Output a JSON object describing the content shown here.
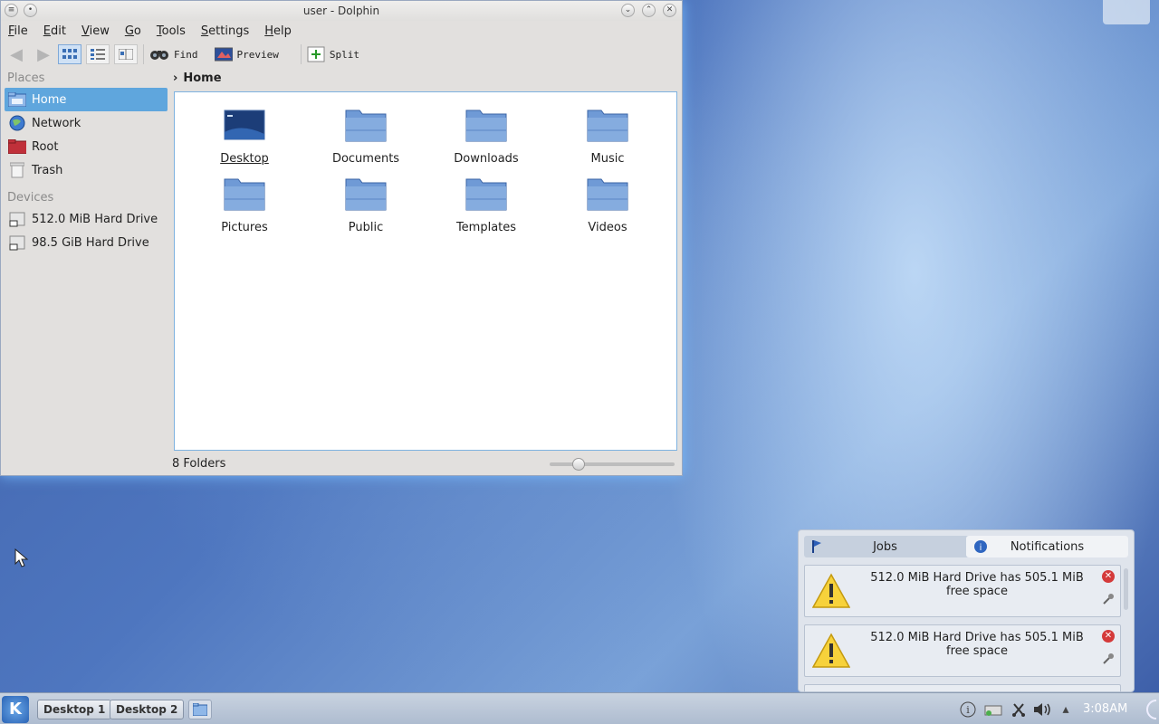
{
  "window": {
    "title": "user - Dolphin",
    "menu": [
      {
        "key": "F",
        "rest": "ile"
      },
      {
        "key": "E",
        "rest": "dit"
      },
      {
        "key": "V",
        "rest": "iew"
      },
      {
        "key": "G",
        "rest": "o"
      },
      {
        "key": "T",
        "rest": "ools"
      },
      {
        "key": "S",
        "rest": "ettings"
      },
      {
        "key": "H",
        "rest": "elp"
      }
    ],
    "toolbar": {
      "find_label": "Find",
      "preview_label": "Preview",
      "split_label": "Split"
    }
  },
  "places": {
    "places_heading": "Places",
    "items": [
      "Home",
      "Network",
      "Root",
      "Trash"
    ],
    "devices_heading": "Devices",
    "devices": [
      "512.0 MiB Hard Drive",
      "98.5 GiB Hard Drive"
    ]
  },
  "breadcrumb": {
    "current": "Home"
  },
  "files": [
    "Desktop",
    "Documents",
    "Downloads",
    "Music",
    "Pictures",
    "Public",
    "Templates",
    "Videos"
  ],
  "status": {
    "text": "8 Folders",
    "zoom_fraction": 0.2
  },
  "notifications": {
    "tab_jobs": "Jobs",
    "tab_notifications": "Notifications",
    "items": [
      "512.0 MiB Hard Drive has 505.1 MiB free space",
      "512.0 MiB Hard Drive has 505.1 MiB free space"
    ]
  },
  "taskbar": {
    "desktop1": "Desktop 1",
    "desktop2": "Desktop 2",
    "clock": "3:08AM"
  },
  "colors": {
    "selection": "#5fa6dd",
    "folder": "#6f9ad6",
    "accent": "#7eb2e0"
  }
}
